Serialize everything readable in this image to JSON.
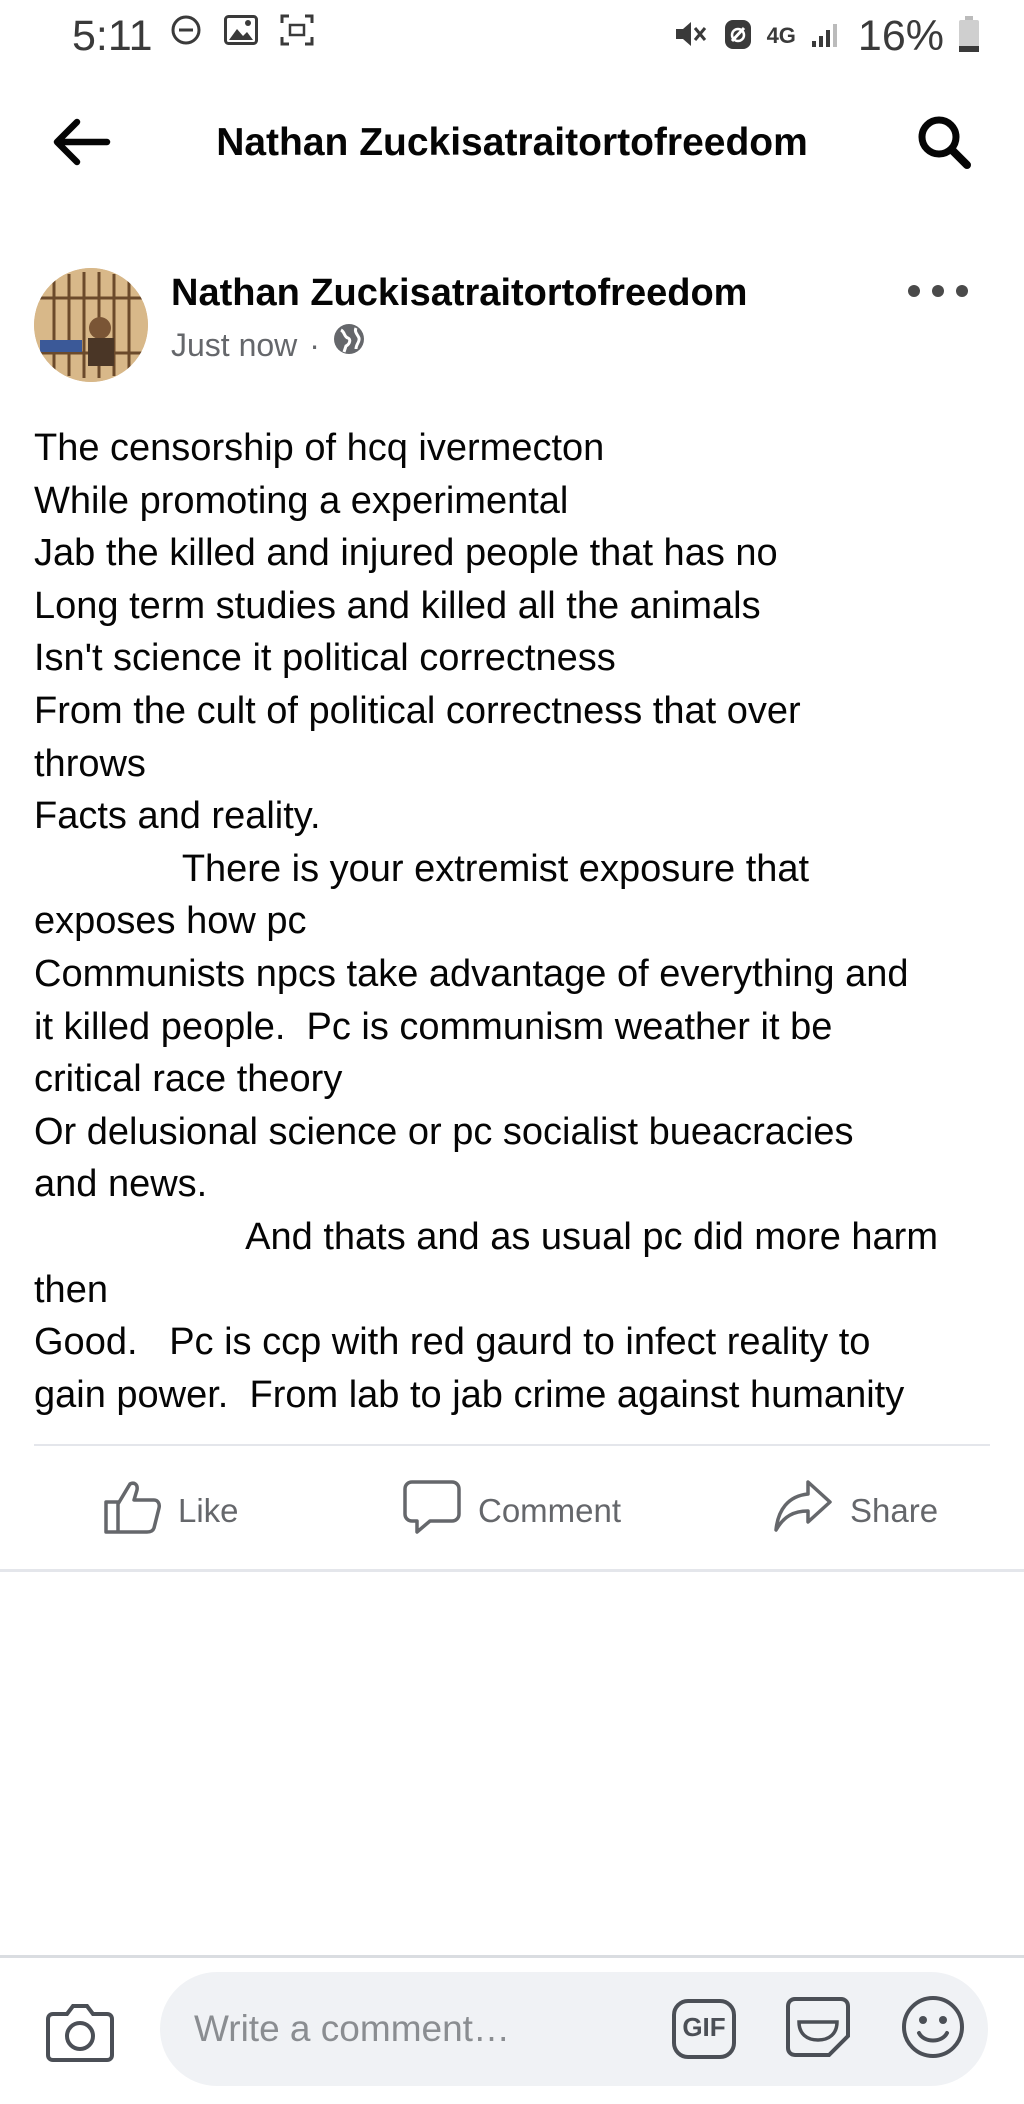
{
  "status_bar": {
    "time": "5:11",
    "network": "4G",
    "battery": "16%"
  },
  "header": {
    "title": "Nathan Zuckisatraitortofreedom",
    "back_icon": "arrow-left-icon",
    "search_icon": "search-icon"
  },
  "post": {
    "author": "Nathan Zuckisatraitortofreedom",
    "timestamp": "Just now",
    "separator": "·",
    "privacy_icon": "globe-icon",
    "more_icon": "more-horizontal-icon",
    "text": "The censorship of hcq ivermecton\nWhile promoting a experimental\nJab the killed and injured people that has no\nLong term studies and killed all the animals\nIsn't science it political correctness\nFrom the cult of political correctness that over\nthrows\nFacts and reality.\n              There is your extremist exposure that\nexposes how pc\nCommunists npcs take advantage of everything and\nit killed people.  Pc is communism weather it be\ncritical race theory\nOr delusional science or pc socialist bueacracies\nand news.\n                    And thats and as usual pc did more harm\nthen\nGood.   Pc is ccp with red gaurd to infect reality to\ngain power.  From lab to jab crime against humanity"
  },
  "actions": {
    "like": "Like",
    "comment": "Comment",
    "share": "Share"
  },
  "composer": {
    "placeholder": "Write a comment…",
    "gif_label": "GIF"
  },
  "colors": {
    "text": "#050505",
    "secondary": "#65676b",
    "divider": "#e4e6eb",
    "input_bg": "#f0f2f5"
  }
}
